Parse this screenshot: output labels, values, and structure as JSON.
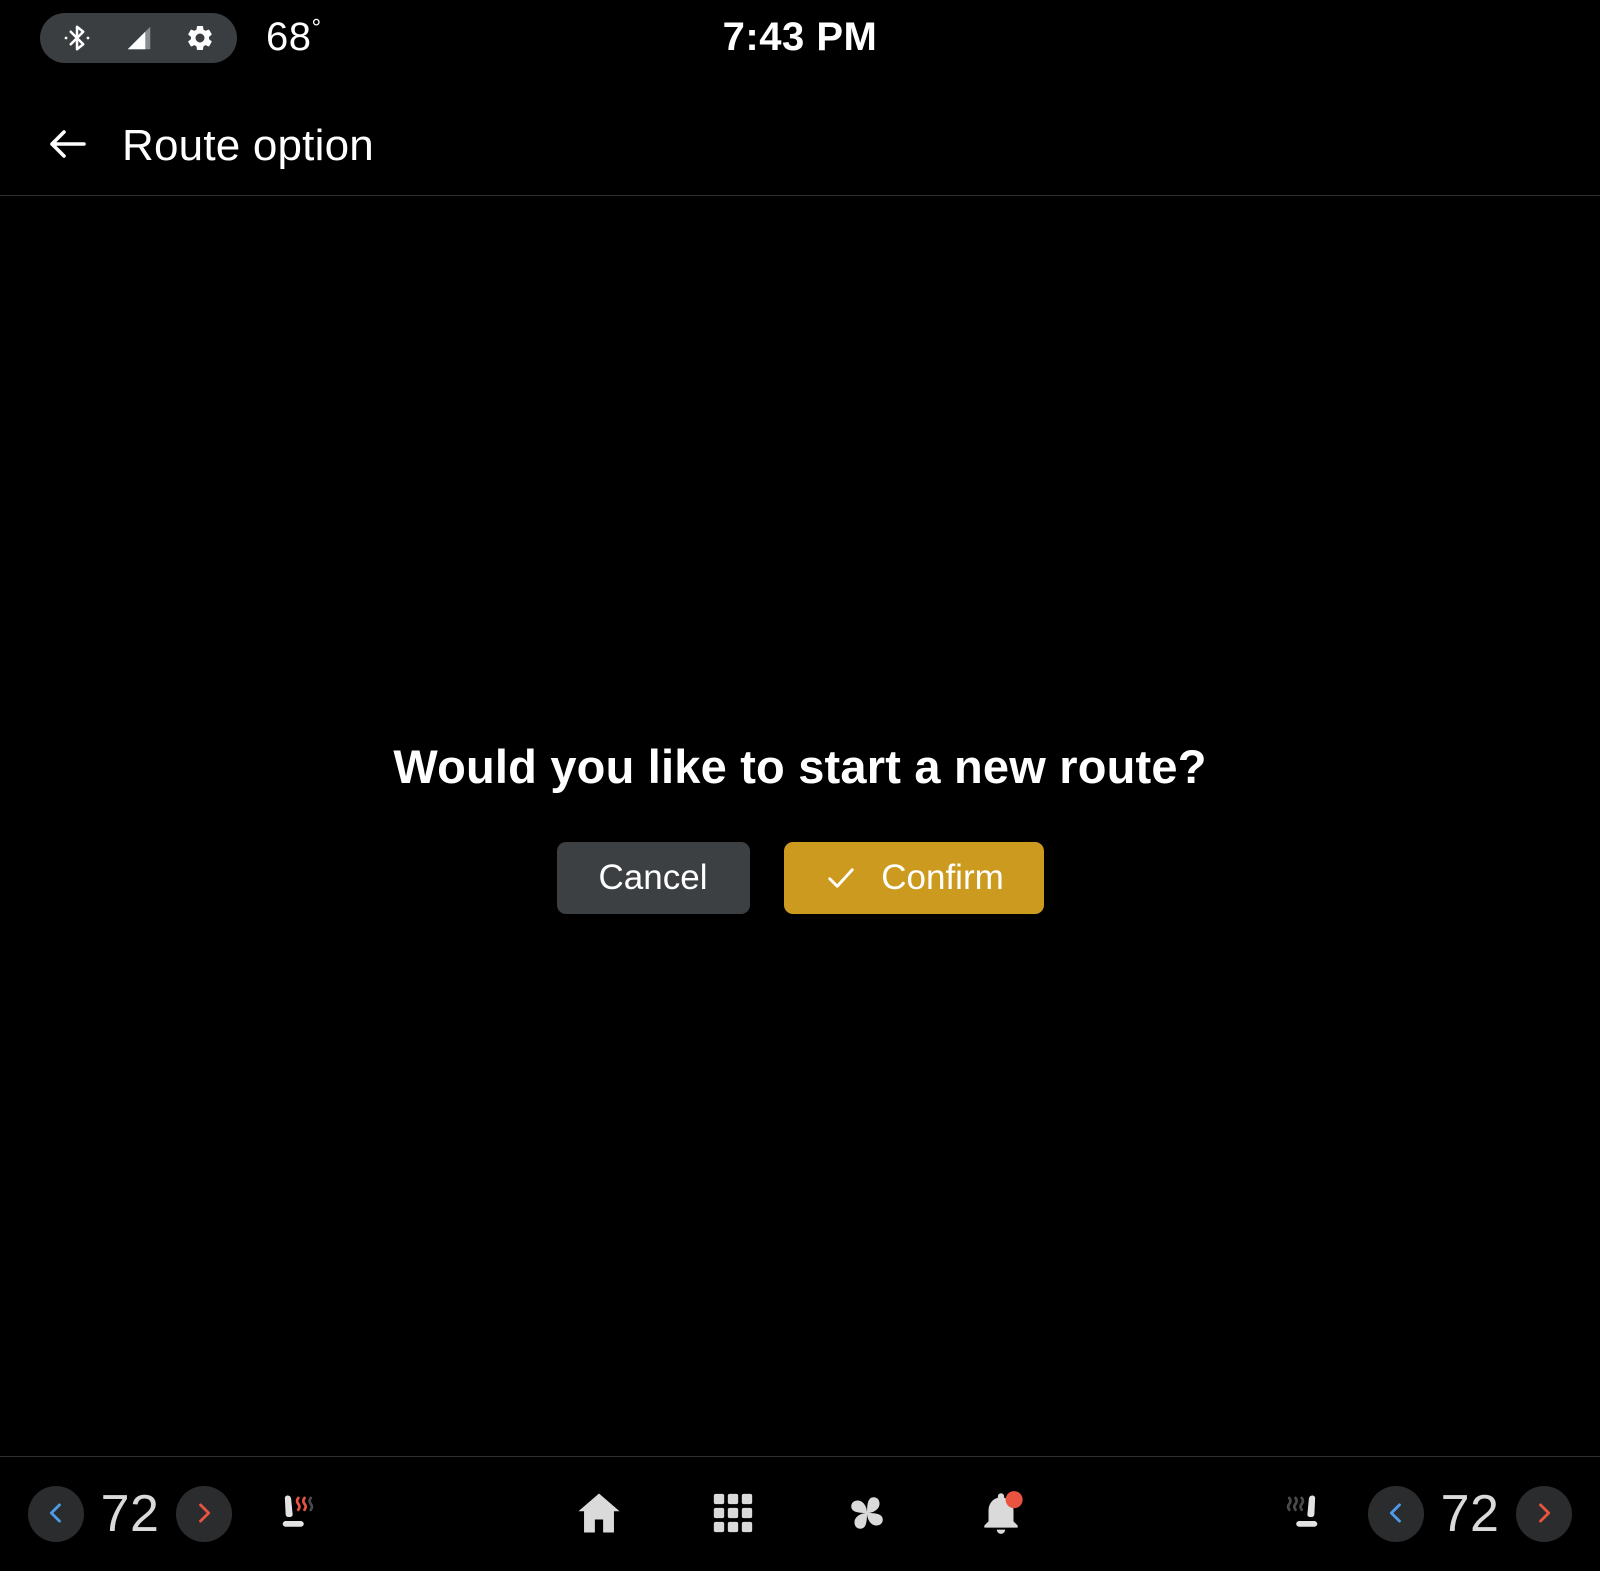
{
  "status_bar": {
    "bluetooth_icon": "bluetooth-icon",
    "signal_icon": "signal-bars-icon",
    "settings_icon": "gear-icon",
    "temperature": "68",
    "degree_symbol": "°",
    "clock": "7:43 PM"
  },
  "header": {
    "back_icon": "arrow-left-icon",
    "title": "Route option"
  },
  "dialog": {
    "message": "Would you like to start a new route?",
    "cancel_label": "Cancel",
    "confirm_label": "Confirm",
    "confirm_icon": "check-icon",
    "confirm_color": "#cc9a1f",
    "cancel_color": "#3c4043"
  },
  "bottom_bar": {
    "left_climate": {
      "decrease_icon": "chevron-left-icon",
      "temperature": "72",
      "increase_icon": "chevron-right-icon",
      "seat_heater_icon": "heated-seat-icon",
      "seat_heater_active": true
    },
    "right_climate": {
      "seat_heater_icon": "heated-seat-icon",
      "seat_heater_active": false,
      "decrease_icon": "chevron-left-icon",
      "temperature": "72",
      "increase_icon": "chevron-right-icon"
    },
    "nav_items": [
      {
        "name": "home",
        "icon": "home-icon"
      },
      {
        "name": "apps",
        "icon": "grid-apps-icon"
      },
      {
        "name": "climate",
        "icon": "fan-icon"
      },
      {
        "name": "notifications",
        "icon": "bell-icon",
        "badge": true
      }
    ],
    "colors": {
      "decrease": "#4e9be8",
      "increase": "#e8543f",
      "badge": "#e8543f",
      "icon": "#dadada"
    }
  }
}
